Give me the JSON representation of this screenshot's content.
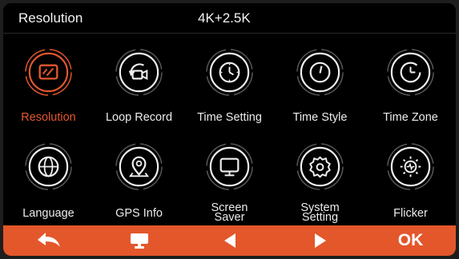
{
  "header": {
    "label": "Resolution",
    "value": "4K+2.5K"
  },
  "colors": {
    "accent": "#e3572b",
    "text": "#ececec",
    "background": "#000000"
  },
  "menu": [
    {
      "label": "Resolution",
      "icon": "resolution-icon",
      "active": true
    },
    {
      "label": "Loop Record",
      "icon": "loop-record-icon"
    },
    {
      "label": "Time Setting",
      "icon": "clock-icon"
    },
    {
      "label": "Time Style",
      "icon": "time-style-icon"
    },
    {
      "label": "Time Zone",
      "icon": "time-zone-icon"
    },
    {
      "label": "Language",
      "icon": "globe-icon"
    },
    {
      "label": "GPS Info",
      "icon": "map-pin-icon"
    },
    {
      "label_line1": "Screen",
      "label_line2": "Saver",
      "icon": "monitor-icon"
    },
    {
      "label_line1": "System",
      "label_line2": "Setting",
      "icon": "gear-icon"
    },
    {
      "label": "Flicker",
      "icon": "flicker-icon"
    }
  ],
  "footer": {
    "buttons": [
      {
        "icon": "back-arrow-icon"
      },
      {
        "icon": "home-screen-icon"
      },
      {
        "icon": "left-triangle-icon"
      },
      {
        "icon": "right-triangle-icon"
      },
      {
        "label": "OK"
      }
    ]
  }
}
